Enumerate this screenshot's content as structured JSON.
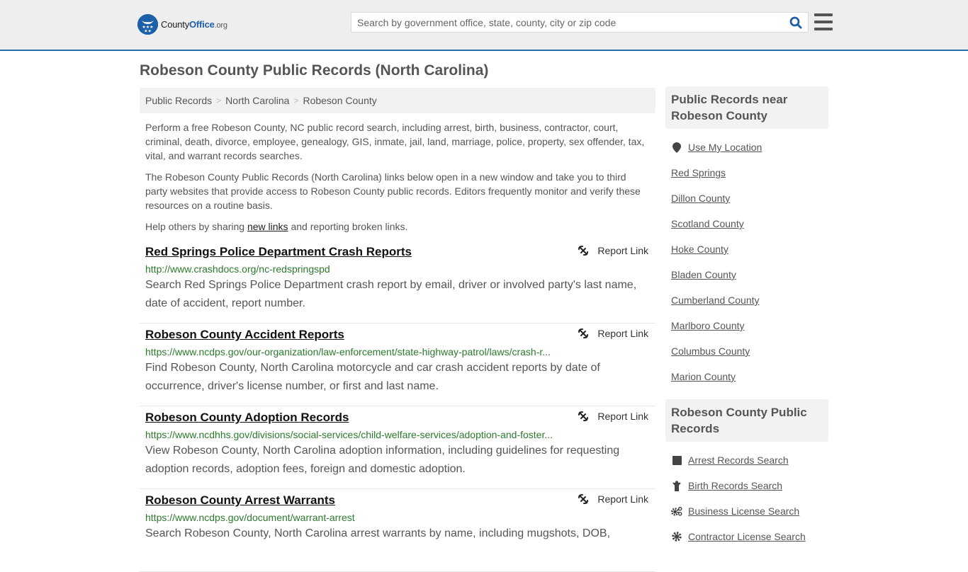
{
  "header": {
    "logo": {
      "name_part1": "County",
      "name_part2": "Office",
      "name_part3": ".org",
      "icon": "eagle-badge-icon",
      "brand_color": "#1d5fa8"
    },
    "search": {
      "placeholder": "Search by government office, state, county, city or zip code",
      "value": "",
      "icon": "search-icon"
    },
    "menu_icon": "hamburger-menu-icon",
    "accent_border_color": "#2a6fa8"
  },
  "page": {
    "title": "Robeson County Public Records (North Carolina)"
  },
  "breadcrumb": [
    {
      "label": "Public Records"
    },
    {
      "label": "North Carolina"
    },
    {
      "label": "Robeson County"
    }
  ],
  "breadcrumb_separator": ">",
  "intro": {
    "p1": "Perform a free Robeson County, NC public record search, including arrest, birth, business, contractor, court, criminal, death, divorce, employee, genealogy, GIS, inmate, jail, land, marriage, police, property, sex offender, tax, vital, and warrant records searches.",
    "p2": "The Robeson County Public Records (North Carolina) links below open in a new window and take you to third party websites that provide access to Robeson County public records. Editors frequently monitor and verify these resources on a routine basis.",
    "p3_before": "Help others by sharing ",
    "p3_link": "new links",
    "p3_after": " and reporting broken links."
  },
  "report_link_label": "Report Link",
  "records": [
    {
      "title": "Red Springs Police Department Crash Reports",
      "url": "http://www.crashdocs.org/nc-redspringspd",
      "description": "Search Red Springs Police Department crash report by email, driver or involved party's last name, date of accident, report number."
    },
    {
      "title": "Robeson County Accident Reports",
      "url": "https://www.ncdps.gov/our-organization/law-enforcement/state-highway-patrol/laws/crash-r...",
      "description": "Find Robeson County, North Carolina motorcycle and car crash accident reports by date of occurrence, driver's license number, or first and last name."
    },
    {
      "title": "Robeson County Adoption Records",
      "url": "https://www.ncdhhs.gov/divisions/social-services/child-welfare-services/adoption-and-foster...",
      "description": "View Robeson County, North Carolina adoption information, including guidelines for requesting adoption records, adoption fees, foreign and domestic adoption."
    },
    {
      "title": "Robeson County Arrest Warrants",
      "url": "https://www.ncdps.gov/document/warrant-arrest",
      "description": "Search Robeson County, North Carolina arrest warrants by name, including mugshots, DOB,"
    }
  ],
  "sidebar": {
    "nearby": {
      "heading": "Public Records near Robeson County",
      "use_location": {
        "label": "Use My Location",
        "icon": "map-marker-icon"
      },
      "items": [
        {
          "label": "Red Springs"
        },
        {
          "label": "Dillon County"
        },
        {
          "label": "Scotland County"
        },
        {
          "label": "Hoke County"
        },
        {
          "label": "Bladen County"
        },
        {
          "label": "Cumberland County"
        },
        {
          "label": "Marlboro County"
        },
        {
          "label": "Columbus County"
        },
        {
          "label": "Marion County"
        }
      ]
    },
    "county_records": {
      "heading": "Robeson County Public Records",
      "items": [
        {
          "label": "Arrest Records Search",
          "icon": "square-icon"
        },
        {
          "label": "Birth Records Search",
          "icon": "child-icon"
        },
        {
          "label": "Business License Search",
          "icon": "cogs-icon"
        },
        {
          "label": "Contractor License Search",
          "icon": "gear-icon"
        }
      ]
    }
  }
}
